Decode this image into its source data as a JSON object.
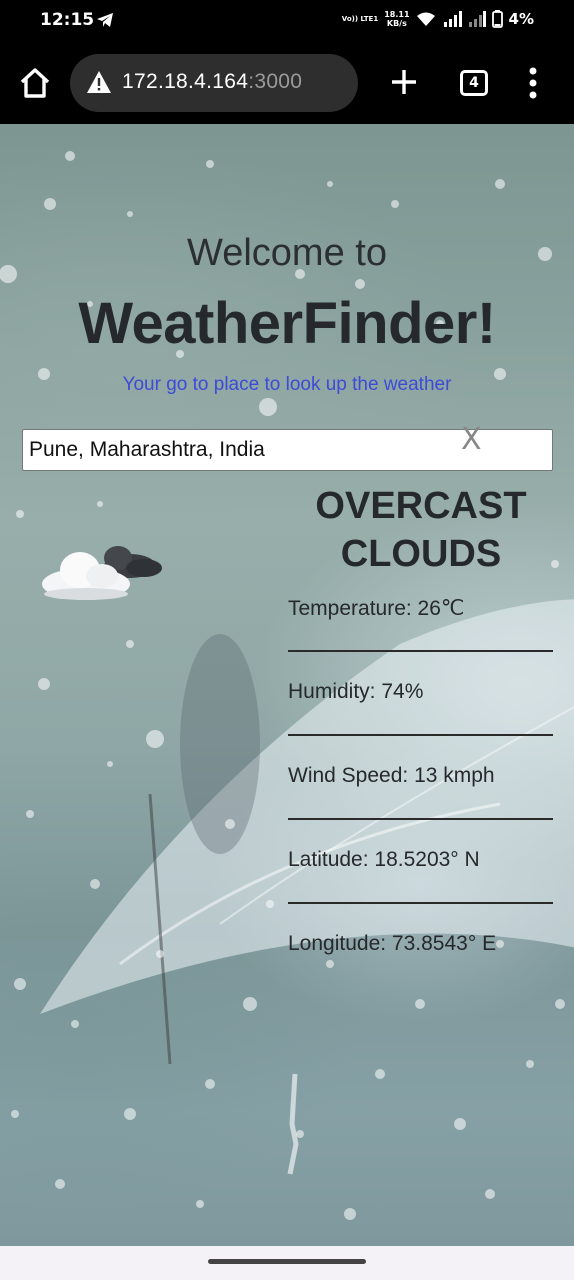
{
  "status_bar": {
    "time": "12:15",
    "volte": "Vo)) LTE1",
    "net_speed_value": "18.11",
    "net_speed_unit": "KB/s",
    "battery": "4%"
  },
  "browser": {
    "url_host": "172.18.4.164",
    "url_port": ":3000",
    "tab_count": "4"
  },
  "page": {
    "welcome": "Welcome to",
    "title": "WeatherFinder!",
    "tagline": "Your go to place to look up the weather",
    "search": {
      "value": "Pune, Maharashtra, India",
      "clear_label": "X"
    },
    "condition_line1": "OVERCAST",
    "condition_line2": "CLOUDS",
    "stats": [
      {
        "label": "Temperature: 26℃"
      },
      {
        "label": "Humidity: 74%"
      },
      {
        "label": "Wind Speed: 13 kmph"
      },
      {
        "label": "Latitude: 18.5203° N"
      },
      {
        "label": "Longitude: 73.8543° E"
      }
    ]
  },
  "icons": {
    "home": "home-icon",
    "warning": "warning-icon",
    "add": "plus-icon",
    "menu": "more-vert-icon",
    "weather": "overcast-clouds-icon"
  }
}
